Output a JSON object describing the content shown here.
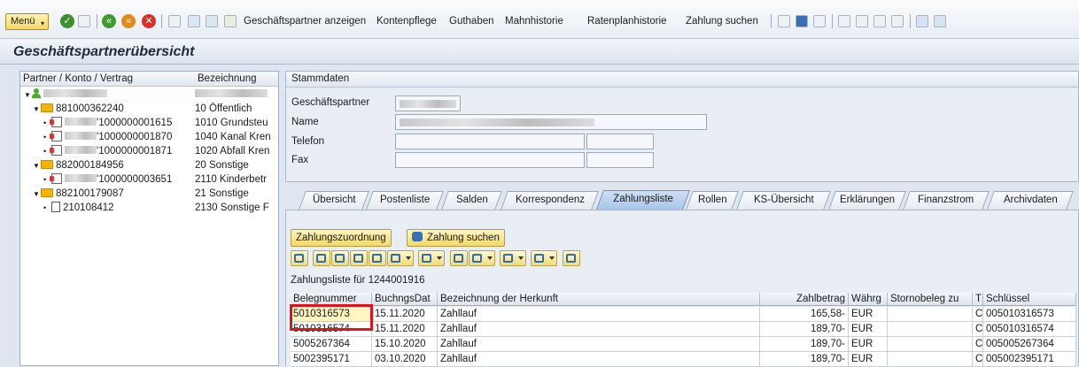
{
  "toolbar": {
    "menu_label": "Menü",
    "links": [
      "Geschäftspartner anzeigen",
      "Kontenpflege",
      "Guthaben",
      "Mahnhistorie",
      "Ratenplanhistorie",
      "Zahlung suchen"
    ]
  },
  "title": "Geschäftspartnerübersicht",
  "tree": {
    "col1": "Partner / Konto / Vertrag",
    "col2": "Bezeichnung",
    "rows": [
      {
        "left": "",
        "right": ""
      },
      {
        "left": "881000362240",
        "right": "10     Öffentlich"
      },
      {
        "left": "'1000000001615",
        "right": "1010 Grundsteu"
      },
      {
        "left": "'1000000001870",
        "right": "1040 Kanal Kren"
      },
      {
        "left": "'1000000001871",
        "right": "1020 Abfall Kren"
      },
      {
        "left": "882000184956",
        "right": "20     Sonstige"
      },
      {
        "left": "'1000000003651",
        "right": "2110 Kinderbetr"
      },
      {
        "left": "882100179087",
        "right": "21     Sonstige"
      },
      {
        "left": "210108412",
        "right": "2130 Sonstige F"
      }
    ]
  },
  "stammdaten": {
    "title": "Stammdaten",
    "labels": {
      "gp": "Geschäftspartner",
      "name": "Name",
      "telefon": "Telefon",
      "fax": "Fax"
    }
  },
  "tabs": [
    "Übersicht",
    "Postenliste",
    "Salden",
    "Korrespondenz",
    "Zahlungsliste",
    "Rollen",
    "KS-Übersicht",
    "Erklärungen",
    "Finanzstrom",
    "Archivdaten"
  ],
  "active_tab": "Zahlungsliste",
  "buttons": {
    "zuordnung": "Zahlungszuordnung",
    "suchen": "Zahlung suchen"
  },
  "list_title": "Zahlungsliste für 1244001916",
  "table": {
    "headers": [
      "Belegnummer",
      "BuchngsDat",
      "Bezeichnung der Herkunft",
      "Zahlbetrag",
      "Währg",
      "Stornobeleg zu",
      "T",
      "Schlüssel"
    ],
    "rows": [
      [
        "5010316573",
        "15.11.2020",
        "Zahllauf",
        "165,58-",
        "EUR",
        "",
        "C",
        "005010316573"
      ],
      [
        "5010316574",
        "15.11.2020",
        "Zahllauf",
        "189,70-",
        "EUR",
        "",
        "C",
        "005010316574"
      ],
      [
        "5005267364",
        "15.10.2020",
        "Zahllauf",
        "189,70-",
        "EUR",
        "",
        "C",
        "005005267364"
      ],
      [
        "5002395171",
        "03.10.2020",
        "Zahllauf",
        "189,70-",
        "EUR",
        "",
        "C",
        "005002395171"
      ]
    ]
  }
}
